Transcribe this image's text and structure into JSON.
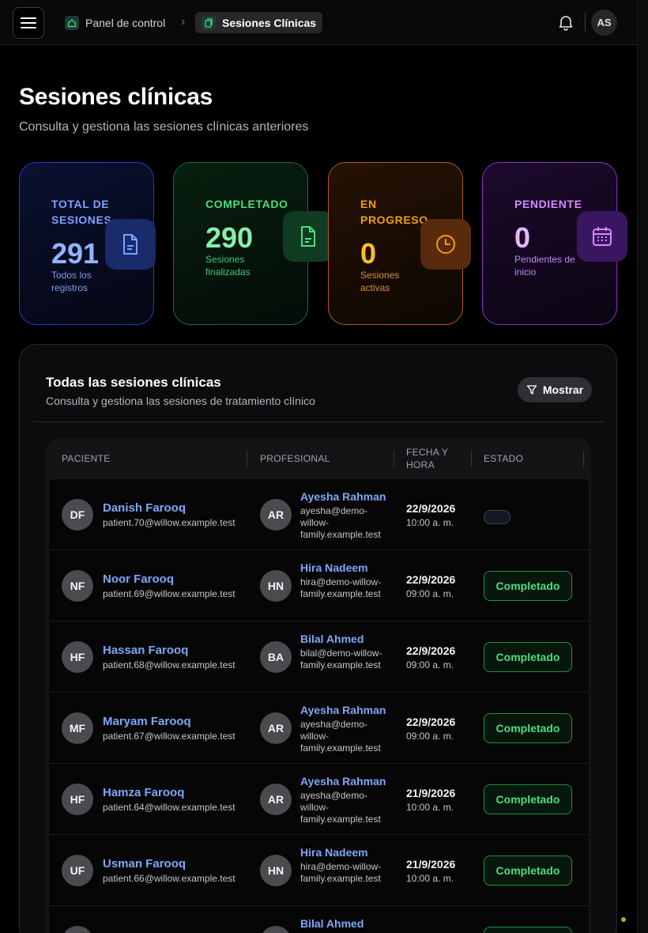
{
  "header": {
    "breadcrumb": [
      {
        "label": "Panel de control"
      },
      {
        "label": "Sesiones Clínicas"
      }
    ],
    "user_initials": "AS"
  },
  "page": {
    "title": "Sesiones clínicas",
    "subtitle": "Consulta y gestiona las sesiones clínicas anteriores"
  },
  "stats": [
    {
      "label": "TOTAL DE SESIONES",
      "value": "291",
      "desc": "Todos los registros",
      "icon": "document-icon",
      "color": "#93b4ff"
    },
    {
      "label": "COMPLETADO",
      "value": "290",
      "desc": "Sesiones finalizadas",
      "icon": "document-check-icon",
      "color": "#4ade80"
    },
    {
      "label": "EN PROGRESO",
      "value": "0",
      "desc": "Sesiones activas",
      "icon": "clock-icon",
      "color": "#f59e0b"
    },
    {
      "label": "PENDIENTE",
      "value": "0",
      "desc": "Pendientes de inicio",
      "icon": "calendar-icon",
      "color": "#d58bff"
    }
  ],
  "sessions_card": {
    "title": "Todas las sesiones clínicas",
    "subtitle": "Consulta y gestiona las sesiones de tratamiento clínico",
    "show_button": "Mostrar",
    "columns": [
      "PACIENTE",
      "PROFESIONAL",
      "FECHA Y HORA",
      "ESTADO"
    ],
    "rows": [
      {
        "patient_initials": "DF",
        "patient_name": "Danish Farooq",
        "patient_email": "patient.70@willow.example.test",
        "pro_initials": "AR",
        "pro_name": "Ayesha Rahman",
        "pro_email": "ayesha@demo-willow-family.example.test",
        "date": "22/9/2026",
        "time": "10:00 a. m.",
        "status": ""
      },
      {
        "patient_initials": "NF",
        "patient_name": "Noor Farooq",
        "patient_email": "patient.69@willow.example.test",
        "pro_initials": "HN",
        "pro_name": "Hira Nadeem",
        "pro_email": "hira@demo-willow-family.example.test",
        "date": "22/9/2026",
        "time": "09:00 a. m.",
        "status": "Completado"
      },
      {
        "patient_initials": "HF",
        "patient_name": "Hassan Farooq",
        "patient_email": "patient.68@willow.example.test",
        "pro_initials": "BA",
        "pro_name": "Bilal Ahmed",
        "pro_email": "bilal@demo-willow-family.example.test",
        "date": "22/9/2026",
        "time": "09:00 a. m.",
        "status": "Completado"
      },
      {
        "patient_initials": "MF",
        "patient_name": "Maryam Farooq",
        "patient_email": "patient.67@willow.example.test",
        "pro_initials": "AR",
        "pro_name": "Ayesha Rahman",
        "pro_email": "ayesha@demo-willow-family.example.test",
        "date": "22/9/2026",
        "time": "09:00 a. m.",
        "status": "Completado"
      },
      {
        "patient_initials": "HF",
        "patient_name": "Hamza Farooq",
        "patient_email": "patient.64@willow.example.test",
        "pro_initials": "AR",
        "pro_name": "Ayesha Rahman",
        "pro_email": "ayesha@demo-willow-family.example.test",
        "date": "21/9/2026",
        "time": "10:00 a. m.",
        "status": "Completado"
      },
      {
        "patient_initials": "UF",
        "patient_name": "Usman Farooq",
        "patient_email": "patient.66@willow.example.test",
        "pro_initials": "HN",
        "pro_name": "Hira Nadeem",
        "pro_email": "hira@demo-willow-family.example.test",
        "date": "21/9/2026",
        "time": "10:00 a. m.",
        "status": "Completado"
      },
      {
        "patient_initials": "",
        "patient_name": "",
        "patient_email": "",
        "pro_initials": "",
        "pro_name": "Bilal Ahmed",
        "pro_email": "",
        "date": "",
        "time": "",
        "status": ""
      }
    ]
  }
}
